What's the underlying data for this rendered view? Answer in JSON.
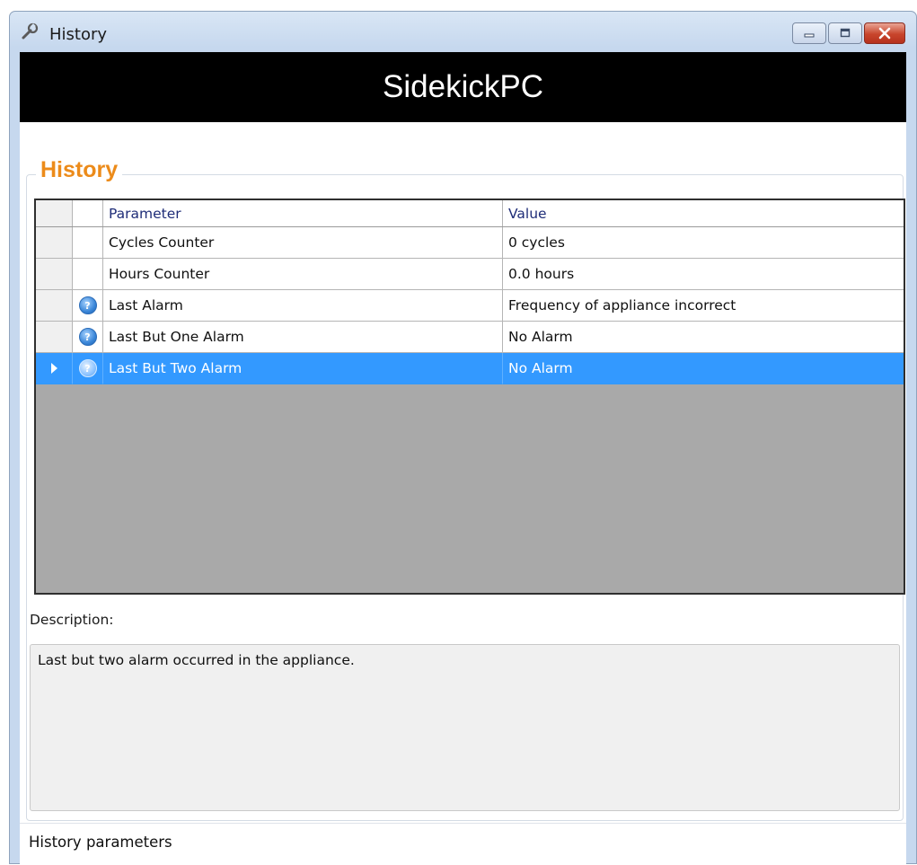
{
  "window": {
    "title": "History",
    "icon": "wrench-icon"
  },
  "banner": {
    "text": "SidekickPC"
  },
  "group": {
    "title": "History"
  },
  "grid": {
    "columns": [
      "Parameter",
      "Value"
    ],
    "rows": [
      {
        "parameter": "Cycles Counter",
        "value": "0 cycles",
        "icon": ""
      },
      {
        "parameter": "Hours Counter",
        "value": "0.0 hours",
        "icon": ""
      },
      {
        "parameter": "Last Alarm",
        "value": "Frequency of appliance incorrect",
        "icon": "help-icon"
      },
      {
        "parameter": "Last But One Alarm",
        "value": "No Alarm",
        "icon": "help-icon"
      },
      {
        "parameter": "Last But Two Alarm",
        "value": "No Alarm",
        "icon": "help-icon",
        "selected": true
      }
    ],
    "colors": {
      "selection": "#3399ff",
      "empty_area": "#a9a9a9"
    }
  },
  "description": {
    "label": "Description:",
    "text": "Last but two alarm occurred in the appliance."
  },
  "status": {
    "text": "History parameters"
  },
  "colors": {
    "group_title": "#ec8b1a",
    "header_text": "#1f2d78",
    "banner_bg": "#000000"
  }
}
